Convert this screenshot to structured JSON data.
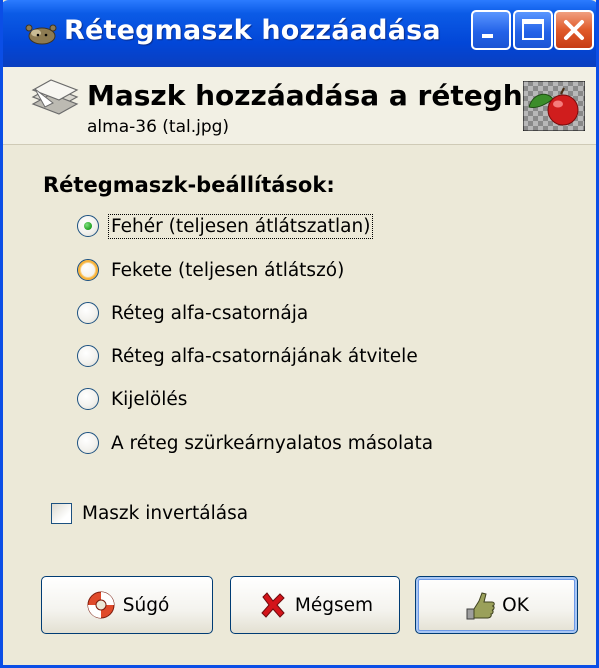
{
  "window": {
    "title": "Rétegmaszk hozzáadása",
    "colors": {
      "titlebar": "#0246d7",
      "frame": "#0b4ee6",
      "face": "#ece9d8",
      "close": "#e05a2a"
    }
  },
  "header": {
    "title": "Maszk hozzáadása a réteghez",
    "subtitle": "alma-36 (tal.jpg)",
    "icon": "layer-mask-icon",
    "thumbnail": "apple-thumbnail"
  },
  "options": {
    "label": "Rétegmaszk-beállítások:",
    "items": [
      {
        "label": "Fehér (teljesen átlátszatlan)",
        "selected": true
      },
      {
        "label": "Fekete (teljesen átlátszó)",
        "selected": false
      },
      {
        "label": "Réteg alfa-csatornája",
        "selected": false
      },
      {
        "label": "Réteg alfa-csatornájának átvitele",
        "selected": false
      },
      {
        "label": "Kijelölés",
        "selected": false
      },
      {
        "label": "A réteg szürkeárnyalatos másolata",
        "selected": false
      }
    ]
  },
  "invert": {
    "label": "Maszk invertálása",
    "checked": false
  },
  "buttons": {
    "help": {
      "label": "Súgó",
      "icon": "lifebuoy-icon"
    },
    "cancel": {
      "label": "Mégsem",
      "icon": "red-x-icon"
    },
    "ok": {
      "label": "OK",
      "icon": "ok-hand-icon"
    }
  }
}
